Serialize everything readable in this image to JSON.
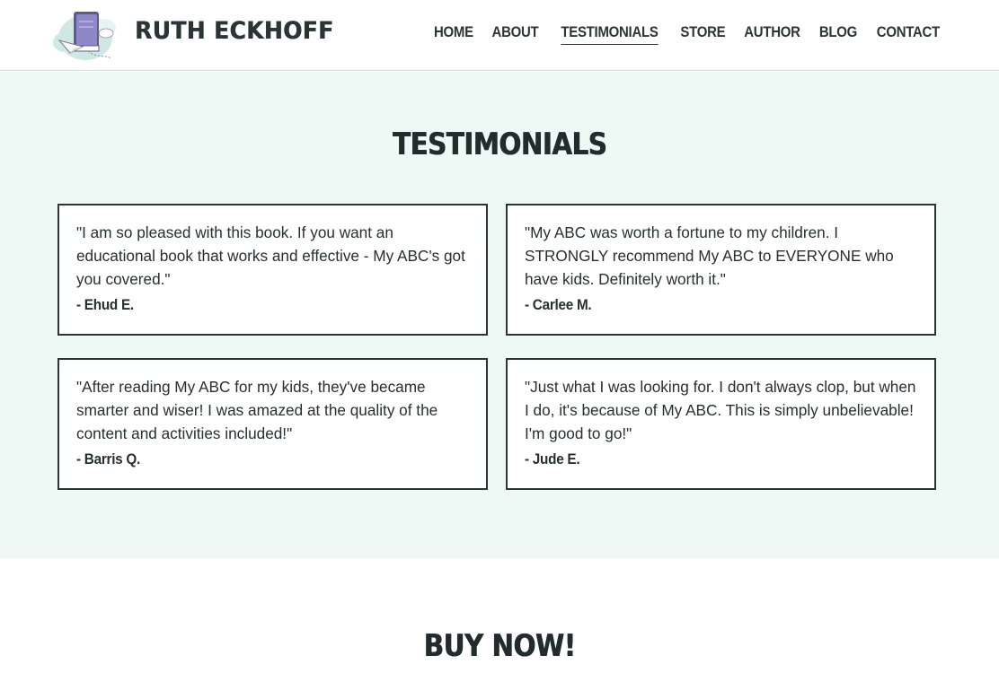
{
  "header": {
    "logo_icon": "book-with-paper-plane-icon",
    "brand": "RUTH ECKHOFF",
    "nav": [
      {
        "label": "HOME",
        "active": false
      },
      {
        "label": "ABOUT",
        "active": false
      },
      {
        "label": "TESTIMONIALS",
        "active": true
      },
      {
        "label": "STORE",
        "active": false
      },
      {
        "label": "AUTHOR",
        "active": false
      },
      {
        "label": "BLOG",
        "active": false
      },
      {
        "label": "CONTACT",
        "active": false
      }
    ]
  },
  "testimonials": {
    "title": "TESTIMONIALS",
    "items": [
      {
        "quote": "\"I am so pleased with this book. If you want an educational book that works and effective - My ABC's got you covered.\"",
        "author": "- Ehud E."
      },
      {
        "quote": "\"My ABC was worth a fortune to my children. I STRONGLY recommend My ABC to EVERYONE who have kids. Definitely worth it.\"",
        "author": "- Carlee M."
      },
      {
        "quote": "\"After reading My ABC for my kids, they've became smarter and wiser! I was amazed at the quality of the content and activities included!\"",
        "author": "- Barris Q."
      },
      {
        "quote": "\"Just what I was looking for. I don't always clop, but when I do, it's because of My ABC. This is simply unbelievable! I'm good to go!\"",
        "author": "- Jude E."
      }
    ]
  },
  "buy": {
    "title": "BUY NOW!"
  },
  "colors": {
    "section_bg": "#eef8f5",
    "text": "#2b3436",
    "card_border": "#2b3436"
  }
}
